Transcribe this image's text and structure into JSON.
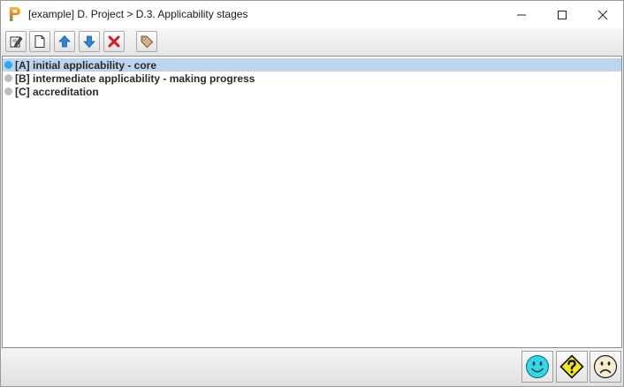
{
  "window": {
    "title": "[example] D. Project > D.3. Applicability stages"
  },
  "toolbar": {
    "buttons": [
      {
        "name": "edit",
        "icon": "edit-icon"
      },
      {
        "name": "new",
        "icon": "new-document-icon"
      },
      {
        "name": "move-up",
        "icon": "arrow-up-icon"
      },
      {
        "name": "move-down",
        "icon": "arrow-down-icon"
      },
      {
        "name": "delete",
        "icon": "delete-x-icon"
      },
      {
        "name": "tag",
        "icon": "tag-icon"
      }
    ]
  },
  "list": {
    "items": [
      {
        "label": "[A] initial applicability - core",
        "selected": true
      },
      {
        "label": "[B] intermediate applicability - making progress",
        "selected": false
      },
      {
        "label": "[C] accreditation",
        "selected": false
      }
    ]
  },
  "bottom_bar": {
    "buttons": [
      {
        "name": "ok",
        "icon": "happy-face-icon"
      },
      {
        "name": "help",
        "icon": "question-sign-icon"
      },
      {
        "name": "cancel",
        "icon": "sad-face-icon"
      }
    ]
  },
  "colors": {
    "selection": "#bcd4ee",
    "dot_selected": "#2fa9f0",
    "dot_default": "#bdbdbd",
    "delete": "#d7191c",
    "arrow": "#2f86d6"
  }
}
